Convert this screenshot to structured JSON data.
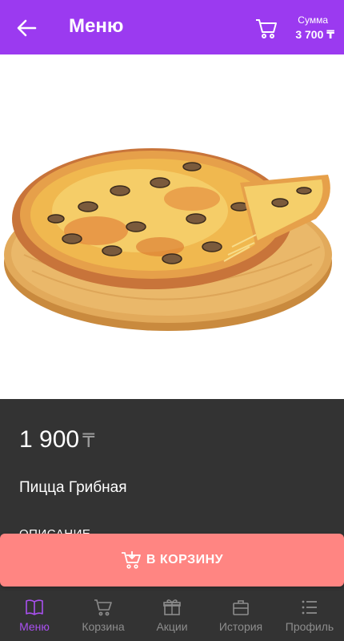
{
  "header": {
    "title": "Меню",
    "sum_label": "Сумма",
    "sum_value": "3 700 ₸"
  },
  "product": {
    "price": "1 900",
    "currency": "₸",
    "name": "Пицца Грибная",
    "description_label": "ОПИСАНИЕ",
    "image": "pizza-photo"
  },
  "actions": {
    "add_to_cart_label": "В КОРЗИНУ"
  },
  "bottom_nav": [
    {
      "label": "Меню",
      "icon": "book-icon",
      "active": true
    },
    {
      "label": "Корзина",
      "icon": "cart-icon",
      "active": false
    },
    {
      "label": "Акции",
      "icon": "gift-icon",
      "active": false
    },
    {
      "label": "История",
      "icon": "briefcase-icon",
      "active": false
    },
    {
      "label": "Профиль",
      "icon": "list-icon",
      "active": false
    }
  ],
  "colors": {
    "primary": "#9b3af0",
    "accent_button": "#ff8582",
    "dark_panel": "#333333",
    "nav_active": "#a950f0",
    "nav_inactive": "#8d8d8d"
  }
}
